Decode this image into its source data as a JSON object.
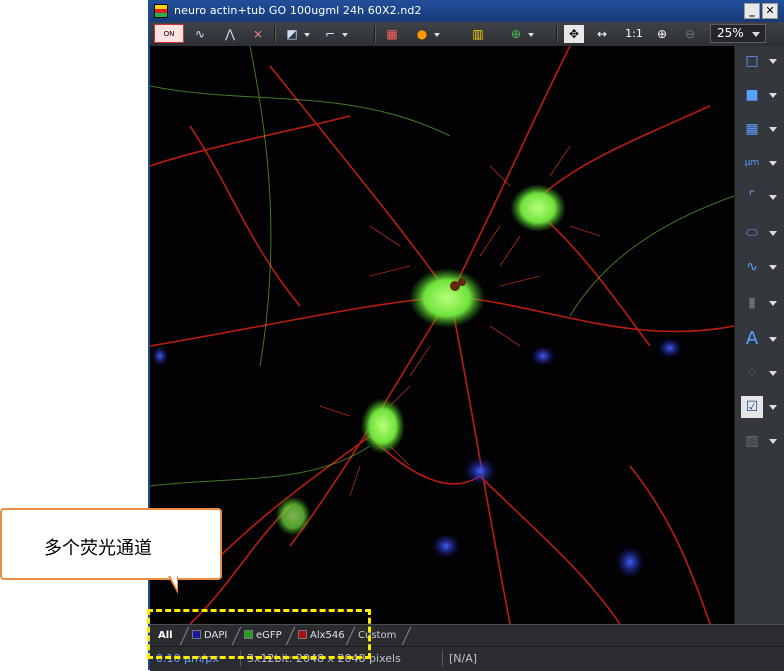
{
  "window": {
    "title": "neuro actin+tub GO 100ugml 24h 60X2.nd2"
  },
  "window_buttons": {
    "minimize": "_",
    "restore": "▭",
    "close": "✕"
  },
  "toolbar": {
    "on_label": "ON",
    "one_to_one": "1:1",
    "zoom_value": "25%"
  },
  "channel_tabs": [
    {
      "label": "All",
      "color": ""
    },
    {
      "label": "DAPI",
      "color": "#1a1aa0"
    },
    {
      "label": "eGFP",
      "color": "#22a020"
    },
    {
      "label": "Alx546",
      "color": "#b01010"
    },
    {
      "label": "Custom",
      "color": ""
    }
  ],
  "status": {
    "scale": "0.10 µm/px",
    "format": "3x12bit: 2048 x 2048 pixels",
    "value": "[N/A]"
  },
  "callout": {
    "text": "多个荧光通道"
  },
  "sidebar_icons": [
    "rectangle-tool-icon",
    "fill-rectangle-icon",
    "grid-icon",
    "measure-um-icon",
    "crop-icon",
    "ellipse-roi-icon",
    "intensity-profile-icon",
    "split-view-icon",
    "text-annotation-icon",
    "dots-icon",
    "checked-image-icon",
    "image-settings-icon"
  ],
  "colors": {
    "accent": "#5aa0ff",
    "callout_border": "#ed8d40",
    "highlight": "#ffec00"
  }
}
